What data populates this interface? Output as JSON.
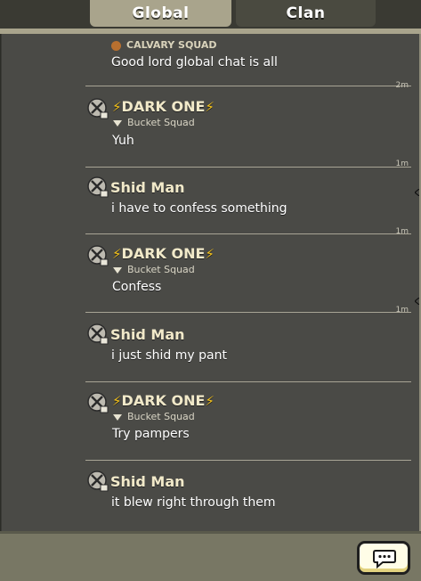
{
  "tabs": {
    "global": "Global",
    "clan": "Clan"
  },
  "messages": [
    {
      "id": "m0",
      "name": "",
      "clan": "CALVARY SQUAD",
      "text": "Good lord global chat is all",
      "time": "2m"
    },
    {
      "id": "m1",
      "name": "DARK ONE",
      "clan": "Bucket Squad",
      "text": "Yuh",
      "time": "1m"
    },
    {
      "id": "m2",
      "name": "Shid Man",
      "clan": "",
      "text": "i have to confess something",
      "time": "1m"
    },
    {
      "id": "m3",
      "name": "DARK ONE",
      "clan": "Bucket Squad",
      "text": "Confess",
      "time": "1m"
    },
    {
      "id": "m4",
      "name": "Shid Man",
      "clan": "",
      "text": "i just shid my pant",
      "time": ""
    },
    {
      "id": "m5",
      "name": "DARK ONE",
      "clan": "Bucket Squad",
      "text": "Try pampers",
      "time": ""
    },
    {
      "id": "m6",
      "name": "Shid Man",
      "clan": "",
      "text": "it blew right through them",
      "time": ""
    }
  ],
  "icons": {
    "role": "crossed-swords-icon",
    "bolt": "lightning-bolt-icon",
    "clan_badge": "chevron-badge-icon",
    "chat": "speech-bubble-icon"
  },
  "colors": {
    "background": "#4a4a46",
    "name": "#f1e9c9",
    "bolt": "#f4c21a",
    "active_tab": "#a9a48c"
  }
}
